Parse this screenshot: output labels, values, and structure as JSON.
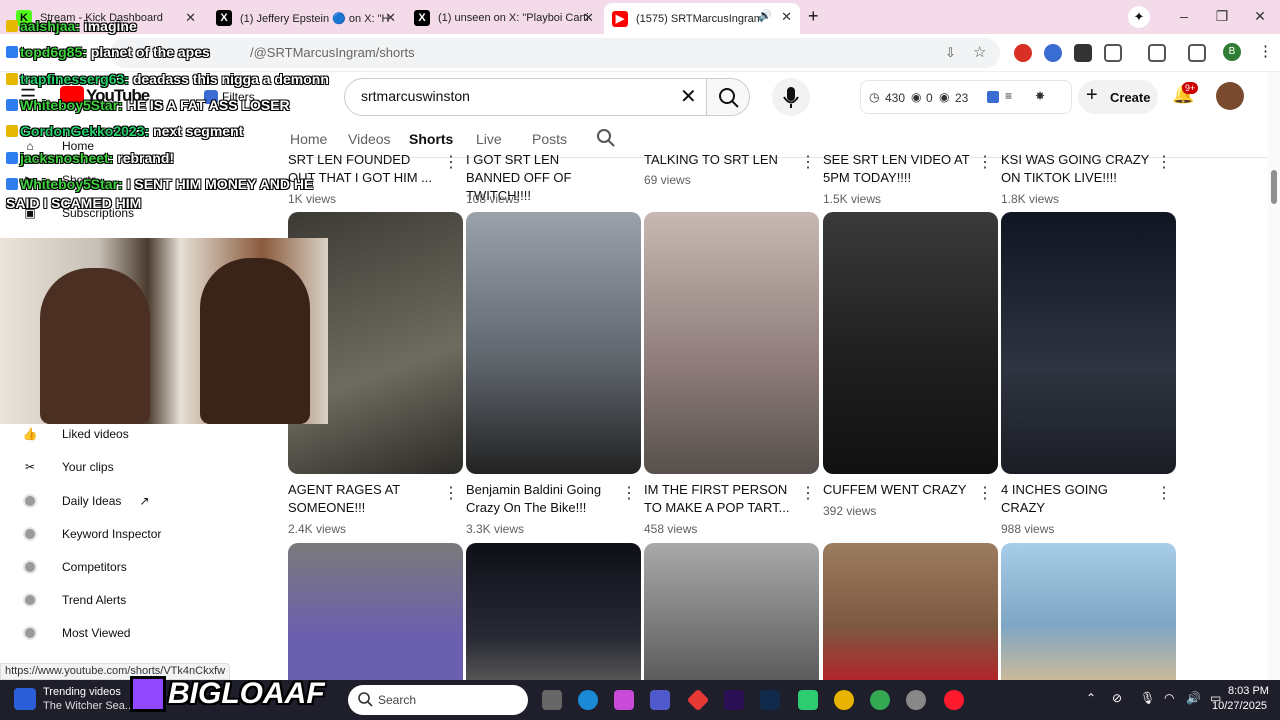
{
  "browser": {
    "tabs": [
      {
        "title": "Stream - Kick Dashboard",
        "icon": "kick-icon",
        "color": "#53fc18"
      },
      {
        "title": "(1) Jeffery Epstein 🔵 on X: \"Ho",
        "icon": "x-icon",
        "color": "#000000"
      },
      {
        "title": "(1) unseen on X: \"Playboi Carti a",
        "icon": "x-icon",
        "color": "#000000"
      },
      {
        "title": "(1575) SRTMarcusIngram -",
        "icon": "youtube-icon",
        "color": "#ff0000"
      }
    ],
    "new_tab": "+",
    "address": "/@SRTMarcusIngram/shorts",
    "status_url": "https://www.youtube.com/shorts/VTk4nCkxfw"
  },
  "youtube": {
    "logo_text": "YouTube",
    "filters_label": "Filters",
    "search_value": "srtmarcuswinston",
    "stats": {
      "a": "430",
      "b": "0",
      "c": "23"
    },
    "create_label": "Create",
    "notif_badge": "9+",
    "avatar_letter": "B"
  },
  "channel_tabs": [
    {
      "label": "Home",
      "active": false
    },
    {
      "label": "Videos",
      "active": false
    },
    {
      "label": "Shorts",
      "active": true
    },
    {
      "label": "Live",
      "active": false
    },
    {
      "label": "Posts",
      "active": false
    }
  ],
  "sidebar": {
    "items": [
      {
        "label": "Home",
        "icon": "home-icon"
      },
      {
        "label": "Shorts",
        "icon": "shorts-icon"
      },
      {
        "label": "Subscriptions",
        "icon": "subscriptions-icon"
      },
      {
        "label": "Liked videos",
        "icon": "thumbs-up-icon"
      },
      {
        "label": "Your clips",
        "icon": "scissors-icon"
      },
      {
        "label": "Daily Ideas",
        "icon": "ext-icon"
      },
      {
        "label": "Keyword Inspector",
        "icon": "ext-icon"
      },
      {
        "label": "Competitors",
        "icon": "ext-icon"
      },
      {
        "label": "Trend Alerts",
        "icon": "ext-icon"
      },
      {
        "label": "Most Viewed",
        "icon": "ext-icon"
      }
    ]
  },
  "shorts_row0": [
    {
      "title": "SRT LEN FOUNDED OUT THAT I GOT HIM ...",
      "views": "1K views"
    },
    {
      "title": "I GOT SRT LEN BANNED OFF OF TWITCH!!!!",
      "views": "108 views"
    },
    {
      "title": "TALKING TO SRT LEN",
      "views": "69 views"
    },
    {
      "title": "SEE SRT LEN VIDEO AT 5PM TODAY!!!!",
      "views": "1.5K views"
    },
    {
      "title": "KSI WAS GOING CRAZY ON TIKTOK LIVE!!!!",
      "views": "1.8K views"
    }
  ],
  "shorts_row1": [
    {
      "title": "AGENT RAGES AT SOMEONE!!!",
      "views": "2.4K views",
      "color": "#5b5a50"
    },
    {
      "title": "Benjamin Baldini Going Crazy On The Bike!!!",
      "views": "3.3K views",
      "color": "#6f7880"
    },
    {
      "title": "IM THE FIRST PERSON TO MAKE A POP TART...",
      "views": "458 views",
      "color": "#8c7a78"
    },
    {
      "title": "CUFFEM WENT CRAZY",
      "views": "392 views",
      "color": "#2a2a2a"
    },
    {
      "title": "4 INCHES GOING CRAZY",
      "views": "988 views",
      "color": "#2e3440"
    }
  ],
  "shorts_row2_colors": [
    "#6b5fb0",
    "#1c1c28",
    "#7c7c7c",
    "#8a6c55",
    "#8fb6d8"
  ],
  "chat": [
    {
      "user": "aalshjaa:",
      "msg": "imagine"
    },
    {
      "user": "topd6g85:",
      "msg": "planet of the apes"
    },
    {
      "user": "trapfinesserg63:",
      "msg": "deadass this nigga a demonn"
    },
    {
      "user": "Whiteboy5Star:",
      "msg": "HE IS A FAT ASS LOSER"
    },
    {
      "user": "GordonGekko2023:",
      "msg": "next segment"
    },
    {
      "user": "jacksnosheet:",
      "msg": "rebrand!"
    },
    {
      "user": "Whiteboy5Star:",
      "msg": "I SENT HIM MONEY AND HE"
    },
    {
      "user": "",
      "msg": "SAID I SCAMED HIM"
    }
  ],
  "stream_overlay": {
    "text": "BIGLOAAF"
  },
  "taskbar": {
    "news_title": "Trending videos",
    "news_sub": "The Witcher Sea...",
    "search_label": "Search",
    "time": "8:03 PM",
    "date": "10/27/2025"
  },
  "colors": {
    "accent": "#ff0000",
    "tab_strip": "#f3dbe9",
    "chat_green": "#3fd23f"
  }
}
